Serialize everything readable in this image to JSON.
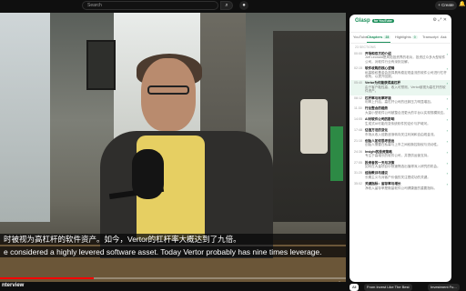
{
  "topbar": {
    "search_placeholder": "Search",
    "create_label": "+ Create"
  },
  "video": {
    "caption_cn": "时被视为高杠杆的软件资产。如今，Vertor的杠杆率大概达到了九倍。",
    "caption_en": "e considered a highly levered software asset. Today Vertor probably has nine times leverage.",
    "progress": 0.27,
    "title_fragment": "nterview"
  },
  "panel": {
    "logo": "Glasp",
    "logo_badge": "for YouTube",
    "head_icons": "⚙ ⤢ ✕",
    "tabs": [
      {
        "label": "YouTube"
      },
      {
        "label": "Chapters",
        "badge": "23",
        "active": true
      },
      {
        "label": "Highlights",
        "badge": "0"
      },
      {
        "label": "Transcript"
      },
      {
        "label": "Ask"
      }
    ],
    "section_label": "23 SECTIONS",
    "items": [
      {
        "time": "00:00",
        "title": "开场和双方的介绍",
        "desc": "Joff Leonard是风险投资界的老兵，投资过众多大型软件公司，对软件行业有深刻见解。"
      },
      {
        "time": "02:15",
        "title": "软件收购的核心逻辑",
        "desc": "私募股权基金会选择具有稳定现金流的软件公司进行杠杆收购，以提升回报。"
      },
      {
        "time": "05:40",
        "title": "Vertor为何能获得高杠杆",
        "desc": "由于客户黏性高、收入可预测，Vertor被视为高杠杆的软件资产。",
        "highlight": true
      },
      {
        "time": "08:12",
        "title": "杠杆率与利率环境",
        "desc": "利率上升后，高杠杆公司的还款压力明显增加。"
      },
      {
        "time": "11:30",
        "title": "行业整合的趋势",
        "desc": "大量小型软件公司被整合进更大的平台以实现规模效应。"
      },
      {
        "time": "14:05",
        "title": "AI对软件公司的影响",
        "desc": "生成式AI可能改变传统软件的定价与护城河。"
      },
      {
        "time": "17:48",
        "title": "估值方法的变化",
        "desc": "市场从收入倍数逐渐转向关注利润和自由现金流。"
      },
      {
        "time": "21:10",
        "title": "创始人如何思考退出",
        "desc": "创始人需要在私募与上市之间权衡控制权与流动性。"
      },
      {
        "time": "24:36",
        "title": "Insight的投资策略",
        "desc": "专注于高增长的软件公司，并提供运营支持。"
      },
      {
        "time": "27:55",
        "title": "投资者的一天与决策",
        "desc": "如何在大量项目中快速筛选出值得深入研究的机会。"
      },
      {
        "time": "31:20",
        "title": "经验教训与建议",
        "desc": "长期主义与对客户价值的关注是成功的关键。"
      },
      {
        "time": "35:02",
        "title": "关键指标：留存率与增长",
        "desc": "净收入留存率是衡量软件公司健康度的重要指标。"
      }
    ]
  },
  "chips": [
    {
      "label": "All",
      "selected": true
    },
    {
      "label": "From Invest Like The Best"
    },
    {
      "label": "Investment Fu..."
    }
  ]
}
